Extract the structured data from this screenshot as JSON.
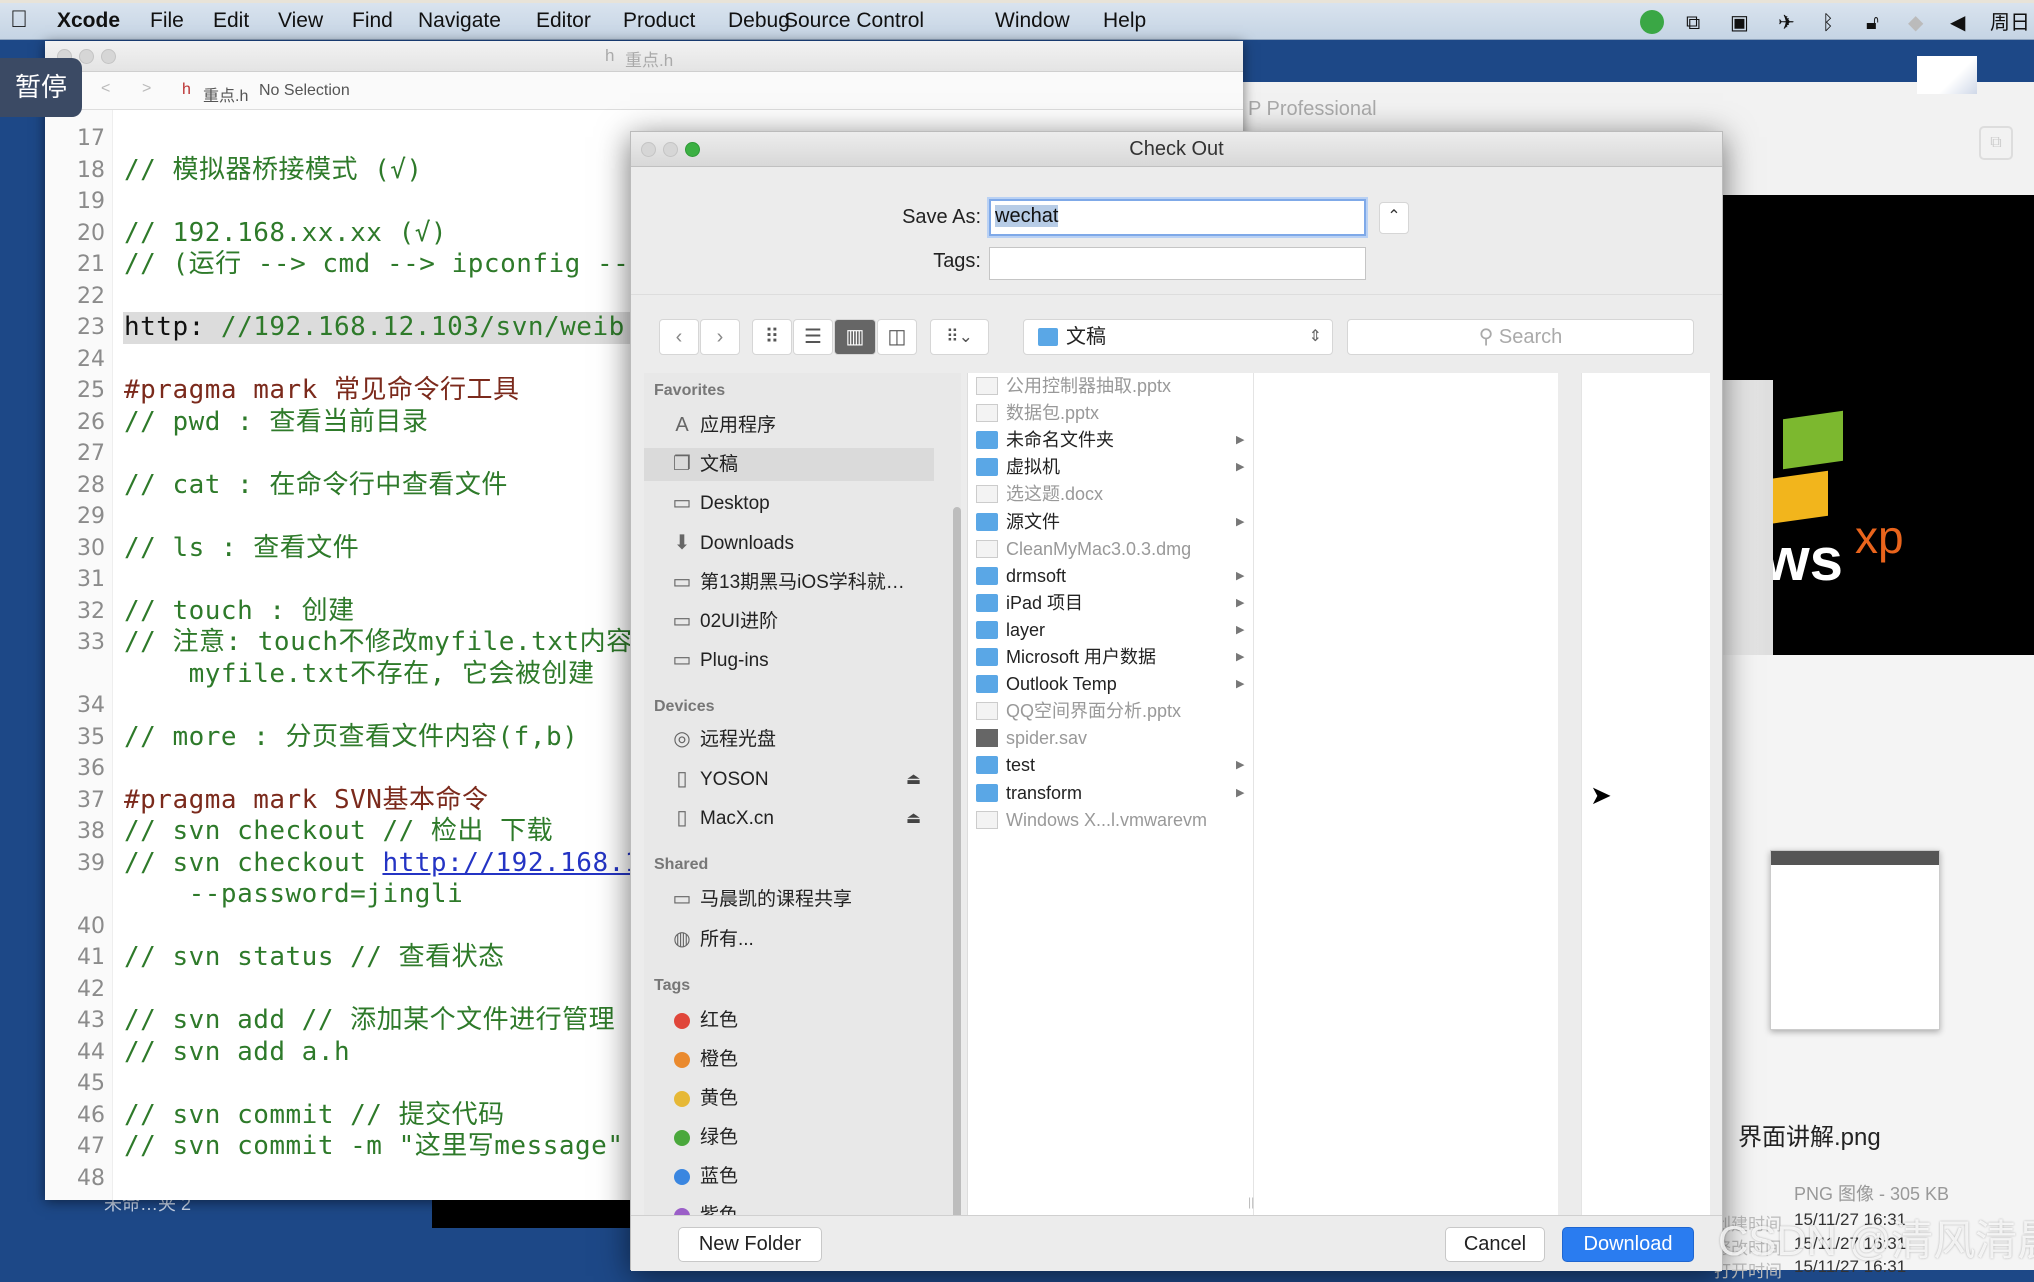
{
  "menubar": {
    "items": [
      "Xcode",
      "File",
      "Edit",
      "View",
      "Find",
      "Navigate",
      "Editor",
      "Product",
      "Debug",
      "Source Control",
      "Window",
      "Help"
    ],
    "clock": "周日"
  },
  "overlay": {
    "pause_label": "暂停"
  },
  "xcode": {
    "title": "重点.h",
    "jump_file": "重点.h",
    "jump_selection": "No Selection",
    "lines": [
      {
        "num": "17",
        "parts": []
      },
      {
        "num": "18",
        "parts": [
          {
            "t": "// 模拟器桥接模式 (√)",
            "c": "comment"
          }
        ]
      },
      {
        "num": "19",
        "parts": []
      },
      {
        "num": "20",
        "parts": [
          {
            "t": "// 192.168.xx.xx (√)",
            "c": "comment"
          }
        ]
      },
      {
        "num": "21",
        "parts": [
          {
            "t": "// (运行 --> cmd --> ipconfig --",
            "c": "comment"
          }
        ]
      },
      {
        "num": "22",
        "parts": []
      },
      {
        "num": "23",
        "hl": true,
        "parts": [
          {
            "t": "http:",
            "c": "plain"
          },
          {
            "t": " //192.168.12.103/svn/weib",
            "c": "comment"
          }
        ]
      },
      {
        "num": "24",
        "parts": []
      },
      {
        "num": "25",
        "parts": [
          {
            "t": "#pragma mark 常见命令行工具",
            "c": "pragma"
          }
        ]
      },
      {
        "num": "26",
        "parts": [
          {
            "t": "// pwd : 查看当前目录",
            "c": "comment"
          }
        ]
      },
      {
        "num": "27",
        "parts": []
      },
      {
        "num": "28",
        "parts": [
          {
            "t": "// cat : 在命令行中查看文件",
            "c": "comment"
          }
        ]
      },
      {
        "num": "29",
        "parts": []
      },
      {
        "num": "30",
        "parts": [
          {
            "t": "// ls : 查看文件",
            "c": "comment"
          }
        ]
      },
      {
        "num": "31",
        "parts": []
      },
      {
        "num": "32",
        "parts": [
          {
            "t": "// touch : 创建",
            "c": "comment"
          }
        ]
      },
      {
        "num": "33",
        "parts": [
          {
            "t": "// 注意: touch不修改myfile.txt内容",
            "c": "comment"
          }
        ]
      },
      {
        "num": "",
        "parts": [
          {
            "t": "    myfile.txt不存在, 它会被创建",
            "c": "comment"
          }
        ]
      },
      {
        "num": "34",
        "parts": []
      },
      {
        "num": "35",
        "parts": [
          {
            "t": "// more : 分页查看文件内容(f,b)",
            "c": "comment"
          }
        ]
      },
      {
        "num": "36",
        "parts": []
      },
      {
        "num": "37",
        "parts": [
          {
            "t": "#pragma mark SVN基本命令",
            "c": "pragma"
          }
        ]
      },
      {
        "num": "38",
        "parts": [
          {
            "t": "// svn checkout // 检出 下载",
            "c": "comment"
          }
        ]
      },
      {
        "num": "39",
        "parts": [
          {
            "t": "// svn checkout ",
            "c": "comment"
          },
          {
            "t": "http://192.168.1",
            "c": "link"
          }
        ]
      },
      {
        "num": "",
        "parts": [
          {
            "t": "    --password=jingli",
            "c": "comment"
          }
        ]
      },
      {
        "num": "40",
        "parts": []
      },
      {
        "num": "41",
        "parts": [
          {
            "t": "// svn status // 查看状态",
            "c": "comment"
          }
        ]
      },
      {
        "num": "42",
        "parts": []
      },
      {
        "num": "43",
        "parts": [
          {
            "t": "// svn add // 添加某个文件进行管理",
            "c": "comment"
          }
        ]
      },
      {
        "num": "44",
        "parts": [
          {
            "t": "// svn add a.h",
            "c": "comment"
          }
        ]
      },
      {
        "num": "45",
        "parts": []
      },
      {
        "num": "46",
        "parts": [
          {
            "t": "// svn commit // 提交代码",
            "c": "comment"
          }
        ]
      },
      {
        "num": "47",
        "parts": [
          {
            "t": "// svn commit -m \"这里写message\"",
            "c": "comment"
          }
        ]
      },
      {
        "num": "48",
        "parts": []
      }
    ]
  },
  "background": {
    "vm_title": "P Professional",
    "xp_logo_text": "ws",
    "xp_logo_sup": "xp",
    "desktop_label": "未命…夹 2",
    "preview_filename": "界面讲解.png",
    "preview_kind": "PNG 图像 - 305 KB",
    "preview_meta": [
      {
        "label": "创建时间",
        "value": "15/11/27 16:31"
      },
      {
        "label": "修改时间",
        "value": "15/11/27 16:31"
      },
      {
        "label": "打开时间",
        "value": "15/11/27 16:31"
      }
    ],
    "watermark": "CSDN @清风清晨"
  },
  "dialog": {
    "title": "Check Out",
    "save_as_label": "Save As:",
    "save_as_value": "wechat",
    "tags_label": "Tags:",
    "tags_value": "",
    "location": "文稿",
    "search_placeholder": "Search",
    "sidebar": {
      "favorites_header": "Favorites",
      "favorites": [
        {
          "label": "应用程序",
          "icon": "applications-icon",
          "glyph": "A"
        },
        {
          "label": "文稿",
          "icon": "documents-icon",
          "glyph": "❐",
          "selected": true
        },
        {
          "label": "Desktop",
          "icon": "desktop-icon",
          "glyph": "▭"
        },
        {
          "label": "Downloads",
          "icon": "downloads-icon",
          "glyph": "⬇"
        },
        {
          "label": "第13期黑马iOS学科就…",
          "icon": "folder-icon",
          "glyph": "▭"
        },
        {
          "label": "02UI进阶",
          "icon": "folder-icon",
          "glyph": "▭"
        },
        {
          "label": "Plug-ins",
          "icon": "folder-icon",
          "glyph": "▭"
        }
      ],
      "devices_header": "Devices",
      "devices": [
        {
          "label": "远程光盘",
          "icon": "disc-icon",
          "glyph": "◎"
        },
        {
          "label": "YOSON",
          "icon": "drive-icon",
          "glyph": "▯",
          "eject": true
        },
        {
          "label": "MacX.cn",
          "icon": "drive-icon",
          "glyph": "▯",
          "eject": true
        }
      ],
      "shared_header": "Shared",
      "shared": [
        {
          "label": "马晨凯的课程共享",
          "icon": "computer-icon",
          "glyph": "▭"
        },
        {
          "label": "所有...",
          "icon": "network-icon",
          "glyph": "◍"
        }
      ],
      "tags_header": "Tags",
      "tags": [
        {
          "label": "红色",
          "color": "#e0463a"
        },
        {
          "label": "橙色",
          "color": "#ea8a2e"
        },
        {
          "label": "黄色",
          "color": "#e6b836"
        },
        {
          "label": "绿色",
          "color": "#4aa83c"
        },
        {
          "label": "蓝色",
          "color": "#3a86e0"
        },
        {
          "label": "紫色",
          "color": "#9b5fc8"
        }
      ]
    },
    "files": [
      {
        "name": "公用控制器抽取.pptx",
        "type": "doc",
        "folder": false
      },
      {
        "name": "数据包.pptx",
        "type": "doc",
        "folder": false
      },
      {
        "name": "未命名文件夹",
        "type": "folder",
        "folder": true
      },
      {
        "name": "虚拟机",
        "type": "folder",
        "folder": true
      },
      {
        "name": "选这题.docx",
        "type": "doc",
        "folder": false
      },
      {
        "name": "源文件",
        "type": "folder",
        "folder": true
      },
      {
        "name": "CleanMyMac3.0.3.dmg",
        "type": "doc",
        "folder": false
      },
      {
        "name": "drmsoft",
        "type": "folder",
        "folder": true
      },
      {
        "name": "iPad 项目",
        "type": "folder",
        "folder": true
      },
      {
        "name": "layer",
        "type": "folder",
        "folder": true
      },
      {
        "name": "Microsoft 用户数据",
        "type": "folder",
        "folder": true
      },
      {
        "name": "Outlook Temp",
        "type": "folder",
        "folder": true
      },
      {
        "name": "QQ空间界面分析.pptx",
        "type": "doc",
        "folder": false
      },
      {
        "name": "spider.sav",
        "type": "dark",
        "folder": false
      },
      {
        "name": "test",
        "type": "folder",
        "folder": true
      },
      {
        "name": "transform",
        "type": "folder",
        "folder": true
      },
      {
        "name": "Windows X...l.vmwarevm",
        "type": "doc",
        "folder": false
      }
    ],
    "new_folder_label": "New Folder",
    "cancel_label": "Cancel",
    "download_label": "Download",
    "accent_color": "#2a7cf0"
  }
}
